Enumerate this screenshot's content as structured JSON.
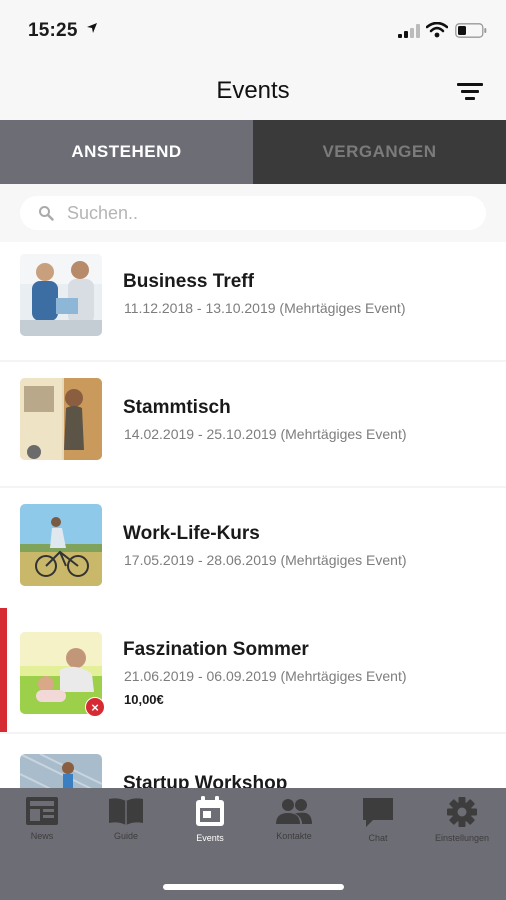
{
  "status_bar": {
    "time": "15:25"
  },
  "header": {
    "title": "Events"
  },
  "tabs": [
    {
      "label": "ANSTEHEND",
      "active": true
    },
    {
      "label": "VERGANGEN",
      "active": false
    }
  ],
  "search": {
    "placeholder": "Suchen.."
  },
  "events": [
    {
      "name": "Business Treff",
      "date": "11.12.2018 - 13.10.2019 (Mehrtägiges Event)",
      "price": "",
      "thumb": "office-team-photo"
    },
    {
      "name": "Stammtisch",
      "date": "14.02.2019 - 25.10.2019 (Mehrtägiges Event)",
      "price": "",
      "thumb": "man-at-food-truck-photo"
    },
    {
      "name": "Work-Life-Kurs",
      "date": "17.05.2019 - 28.06.2019 (Mehrtägiges Event)",
      "price": "",
      "thumb": "cyclist-in-field-photo"
    },
    {
      "name": "Faszination Sommer",
      "date": "21.06.2019 - 06.09.2019 (Mehrtägiges Event)",
      "price": "10,00€",
      "thumb": "family-in-meadow-photo",
      "cancel_badge": "×"
    },
    {
      "name": "Startup Workshop",
      "date": "",
      "price": "",
      "thumb": "runner-photo"
    }
  ],
  "nav": [
    {
      "label": "News",
      "icon": "news-icon",
      "active": false
    },
    {
      "label": "Guide",
      "icon": "book-icon",
      "active": false
    },
    {
      "label": "Events",
      "icon": "calendar-icon",
      "active": true
    },
    {
      "label": "Kontakte",
      "icon": "people-icon",
      "active": false
    },
    {
      "label": "Chat",
      "icon": "chat-bubble-icon",
      "active": false
    },
    {
      "label": "Einstellungen",
      "icon": "gear-icon",
      "active": false
    }
  ],
  "colors": {
    "accent_red": "#d62b32",
    "tab_active": "#6d6d75",
    "tab_inactive": "#3a3a3a",
    "nav_background": "#6d6d75"
  }
}
